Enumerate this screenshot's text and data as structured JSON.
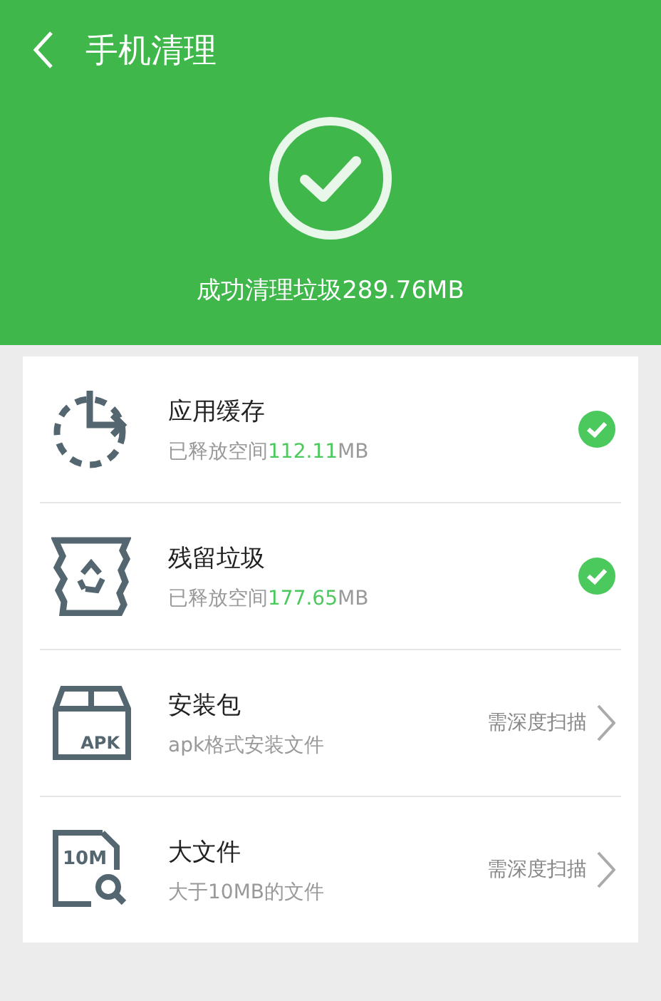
{
  "header": {
    "title": "手机清理",
    "result": "成功清理垃圾289.76MB"
  },
  "items": [
    {
      "kind": "done",
      "title": "应用缓存",
      "detail": "已释放空间",
      "amount": "112.11",
      "unit": "MB"
    },
    {
      "kind": "done",
      "title": "残留垃圾",
      "detail": "已释放空间",
      "amount": "177.65",
      "unit": "MB"
    },
    {
      "kind": "scan",
      "icon_label": "APK",
      "title": "安装包",
      "detail": "apk格式安装文件",
      "action": "需深度扫描"
    },
    {
      "kind": "scan",
      "icon_label": "10M",
      "title": "大文件",
      "detail": "大于10MB的文件",
      "action": "需深度扫描"
    }
  ]
}
